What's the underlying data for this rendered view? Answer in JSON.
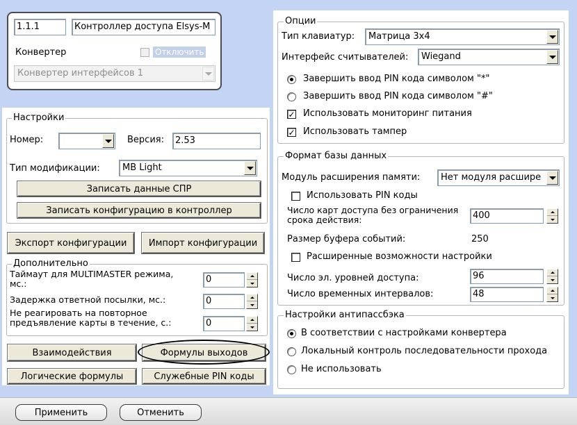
{
  "device": {
    "id": "1.1.1",
    "name": "Контроллер доступа Elsys-M",
    "converter_label": "Конвертер",
    "disable_label": "Отключить",
    "converter_value": "Конвертер интерфейсов 1"
  },
  "settings": {
    "legend": "Настройки",
    "number_label": "Номер:",
    "number_value": "",
    "version_label": "Версия:",
    "version_value": "2.53",
    "mod_label": "Тип модификации:",
    "mod_value": "MB Light",
    "write_spr": "Записать данные СПР",
    "write_config": "Записать конфигурацию в контроллер"
  },
  "io": {
    "export": "Экспорт конфигурации",
    "import": "Импорт конфигурации"
  },
  "additional": {
    "legend": "Дополнительно",
    "timeout_label": "Таймаут для MULTIMASTER режима, мс.:",
    "timeout_value": "0",
    "delay_label": "Задержка ответной посылки, мс.:",
    "delay_value": "0",
    "ignore_label": "Не реагировать на повторное предъявление карты в течение, с.:",
    "ignore_value": "0"
  },
  "bottom_buttons": {
    "interactions": "Взаимодействия",
    "output_formulas": "Формулы выходов",
    "logic_formulas": "Логические формулы",
    "service_pin": "Служебные PIN коды"
  },
  "options": {
    "legend": "Опции",
    "keypad_label": "Тип клавиатур:",
    "keypad_value": "Матрица 3x4",
    "reader_label": "Интерфейс считывателей:",
    "reader_value": "Wiegand",
    "pin_star": "Завершить ввод PIN кода символом \"*\"",
    "pin_hash": "Завершить ввод PIN кода символом \"#\"",
    "power_monitor": "Использовать мониторинг питания",
    "tamper": "Использовать тампер"
  },
  "db": {
    "legend": "Формат базы данных",
    "mem_label": "Модуль расширения памяти:",
    "mem_value": "Нет модуля расшире",
    "use_pin": "Использовать PIN коды",
    "cards_label": "Число карт доступа без ограничения срока действия:",
    "cards_value": "400",
    "buffer_label": "Размер буфера событий:",
    "buffer_value": "250",
    "advanced": "Расширенные возможности настройки",
    "levels_label": "Число эл. уровней доступа:",
    "levels_value": "96",
    "intervals_label": "Число временных интервалов:",
    "intervals_value": "48"
  },
  "antipass": {
    "legend": "Настройки антипассбэка",
    "opt1": "В соответствии с настройками конвертера",
    "opt2": "Локальный  контроль последовательности прохода",
    "opt3": "Не использовать"
  },
  "footer": {
    "apply": "Применить",
    "cancel": "Отменить"
  }
}
